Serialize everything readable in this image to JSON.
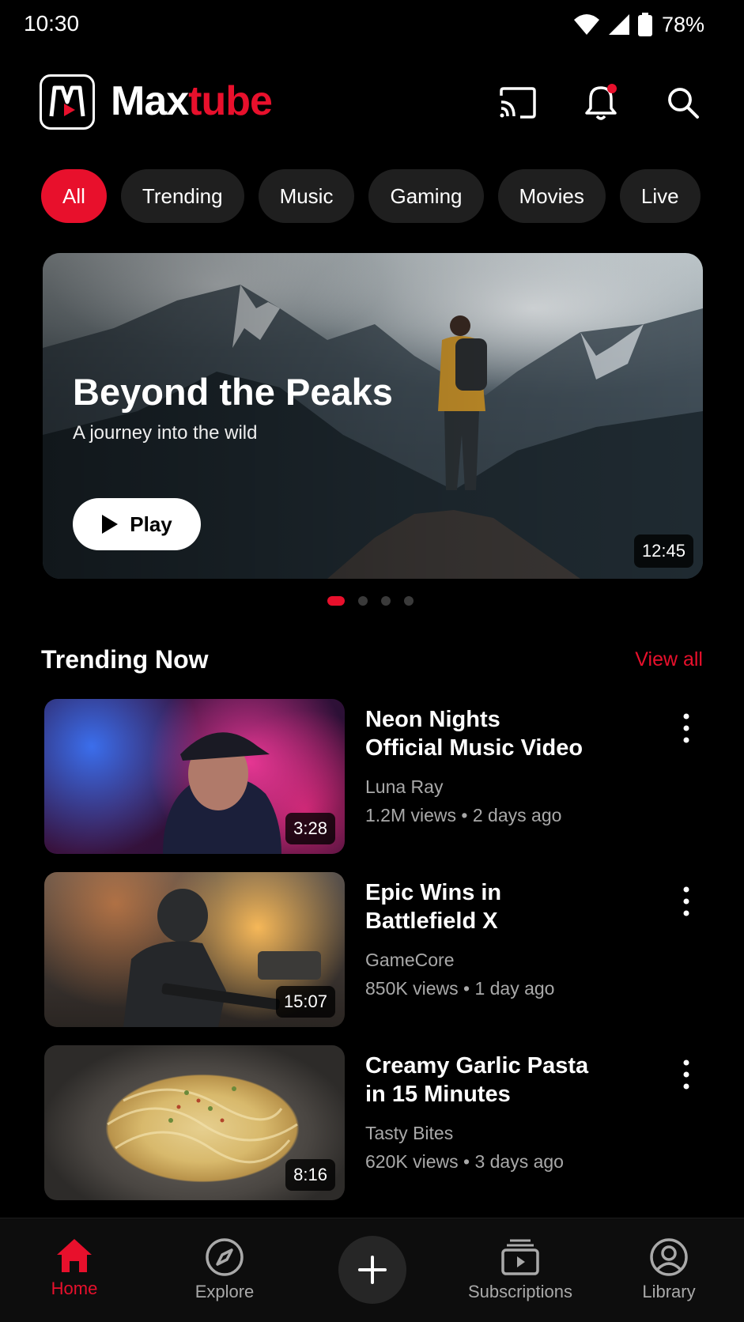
{
  "status_bar": {
    "time": "10:30",
    "battery": "78%"
  },
  "header": {
    "brand_primary": "Max",
    "brand_accent": "tube"
  },
  "chips": [
    "All",
    "Trending",
    "Music",
    "Gaming",
    "Movies",
    "Live"
  ],
  "hero": {
    "title": "Beyond the Peaks",
    "subtitle": "A journey into the wild",
    "play_label": "Play",
    "duration": "12:45",
    "slide_count": 4,
    "active_slide": 1
  },
  "section": {
    "title": "Trending Now",
    "view_all": "View all"
  },
  "videos": [
    {
      "title_line1": "Neon Nights",
      "title_line2": "Official Music Video",
      "channel": "Luna Ray",
      "meta": "1.2M views • 2 days ago",
      "duration": "3:28"
    },
    {
      "title_line1": "Epic Wins in",
      "title_line2": "Battlefield X",
      "channel": "GameCore",
      "meta": "850K views • 1 day ago",
      "duration": "15:07"
    },
    {
      "title_line1": "Creamy Garlic Pasta",
      "title_line2": "in 15 Minutes",
      "channel": "Tasty Bites",
      "meta": "620K views • 3 days ago",
      "duration": "8:16"
    }
  ],
  "nav": {
    "home": "Home",
    "explore": "Explore",
    "subscriptions": "Subscriptions",
    "library": "Library"
  },
  "colors": {
    "accent": "#e8102c",
    "background": "#000000",
    "chip": "#1f1f1f",
    "secondary_text": "#a9a9a9"
  }
}
